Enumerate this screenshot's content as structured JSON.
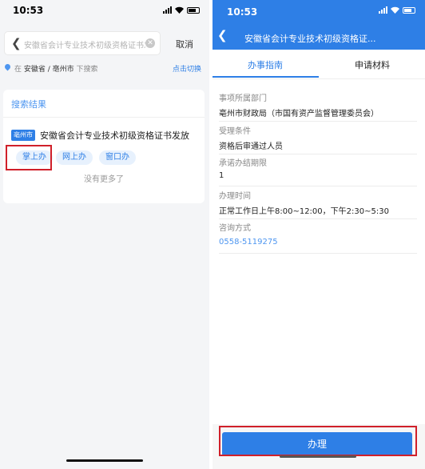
{
  "left": {
    "status_time": "10:53",
    "search": {
      "placeholder": "安徽省会计专业技术初级资格证书发放"
    },
    "cancel_label": "取消",
    "location": {
      "prefix": "在",
      "region": "安徽省 / 亳州市",
      "suffix": "下搜索",
      "switch_label": "点击切换"
    },
    "results_title": "搜索结果",
    "item": {
      "city_tag": "亳州市",
      "title": "安徽省会计专业技术初级资格证书发放",
      "channels": [
        "掌上办",
        "网上办",
        "窗口办"
      ]
    },
    "no_more": "没有更多了"
  },
  "right": {
    "status_time": "10:53",
    "title": "安徽省会计专业技术初级资格证...",
    "tabs": [
      "办事指南",
      "申请材料"
    ],
    "active_tab": 0,
    "info": [
      {
        "label": "事项所属部门",
        "value": "亳州市财政局（市国有资产监督管理委员会）"
      },
      {
        "label": "受理条件",
        "value": "资格后审通过人员"
      },
      {
        "label": "承诺办结期限",
        "value": "1"
      },
      {
        "label": "办理时间",
        "value": "正常工作日上午8:00~12:00，下午2:30~5:30"
      },
      {
        "label": "咨询方式",
        "value": "0558-5119275"
      }
    ],
    "apply_label": "办理"
  },
  "colors": {
    "accent": "#2e7fe6",
    "highlight": "#d0202a"
  }
}
